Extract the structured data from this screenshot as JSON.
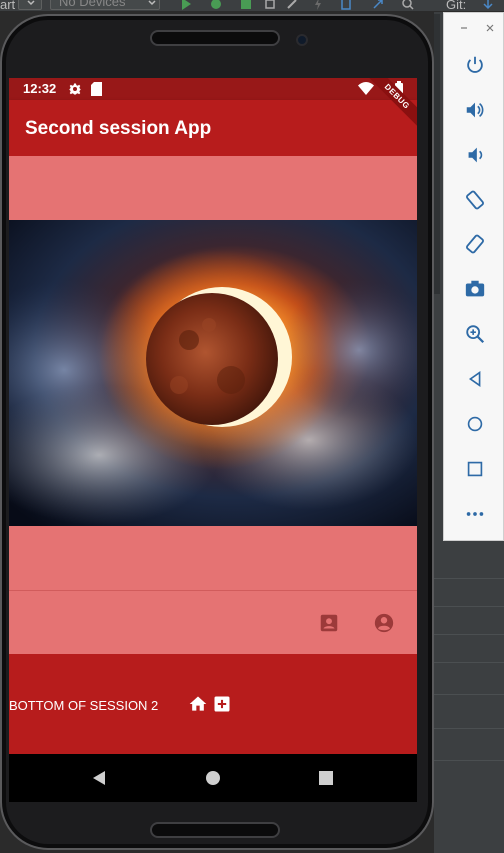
{
  "ide": {
    "config_fragment": "art",
    "device_combo": "No Devices",
    "git_label": "Git:"
  },
  "status_bar": {
    "time": "12:32"
  },
  "app_bar": {
    "title": "Second session App",
    "debug_label": "DEBUG"
  },
  "bottom_bar": {
    "text": "BOTTOM OF SESSION 2"
  },
  "colors": {
    "primary": "#b71c1c",
    "status_bar": "#981818",
    "accent_light": "#e57373"
  },
  "icons": {
    "status": [
      "settings-icon",
      "sd-card-icon",
      "wifi-icon",
      "battery-icon"
    ],
    "content_row": [
      "contact-card-icon",
      "account-circle-icon"
    ],
    "bottom_bar": [
      "home-icon",
      "add-box-icon"
    ],
    "emulator_toolbar": [
      "power-icon",
      "volume-up-icon",
      "volume-down-icon",
      "rotate-left-icon",
      "rotate-right-icon",
      "camera-icon",
      "zoom-icon",
      "back-icon",
      "home-icon",
      "overview-icon",
      "more-icon"
    ],
    "nav": [
      "back-icon",
      "home-icon",
      "recents-icon"
    ]
  }
}
